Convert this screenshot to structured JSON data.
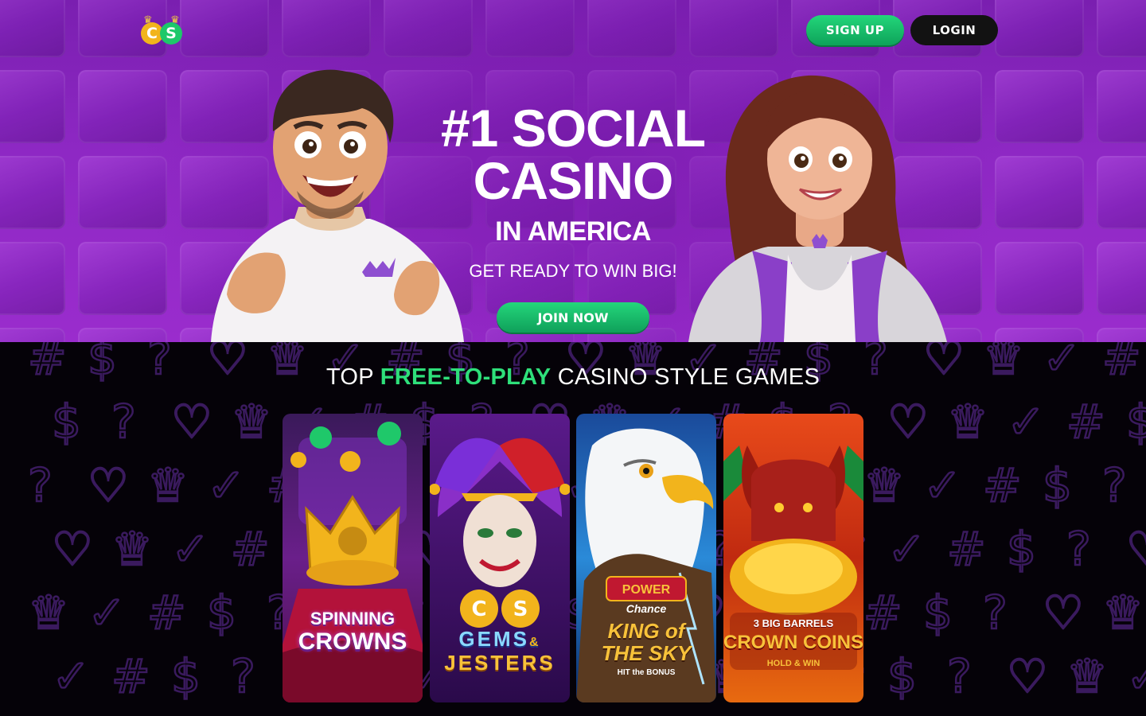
{
  "header": {
    "logo_letters": [
      "C",
      "S"
    ],
    "signup_label": "SIGN UP",
    "login_label": "LOGIN"
  },
  "hero": {
    "headline_line1": "#1 SOCIAL",
    "headline_line2": "CASINO",
    "headline_line3": "IN AMERICA",
    "tagline": "GET READY TO WIN BIG!",
    "join_label": "JOIN NOW"
  },
  "games": {
    "title_prefix": "TOP ",
    "title_highlight": "FREE-TO-PLAY",
    "title_suffix": " CASINO STYLE GAMES",
    "cards": [
      {
        "line1": "SPINNING",
        "line2": "CROWNS"
      },
      {
        "line1": "GEMS",
        "amp": "&",
        "line2": "JESTERS"
      },
      {
        "badge1": "POWER",
        "badge2": "Chance",
        "line1": "KING of",
        "line2": "THE SKY",
        "line3": "HIT the BONUS"
      },
      {
        "line1": "3 BIG BARRELS",
        "line2": "CROWN COINS",
        "line3": "HOLD & WIN"
      }
    ]
  },
  "colors": {
    "accent_green": "#2ee07a",
    "hero_purple": "#8e28c4",
    "login_bg": "#121212"
  }
}
